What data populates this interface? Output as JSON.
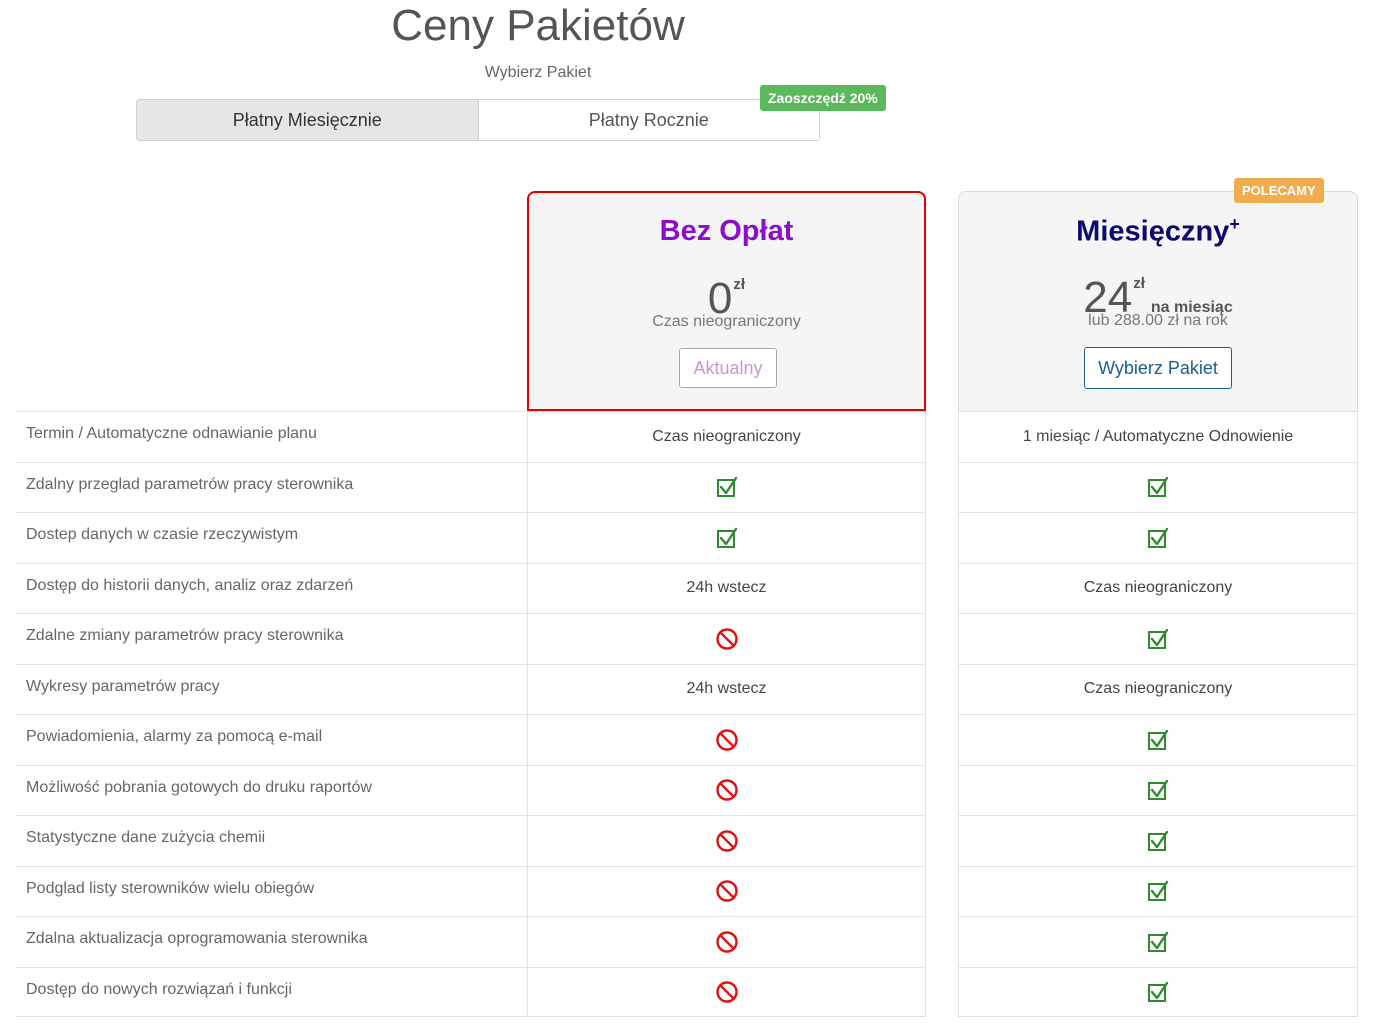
{
  "header": {
    "title": "Ceny Pakietów",
    "subtitle": "Wybierz Pakiet"
  },
  "billing": {
    "monthly_label": "Płatny Miesięcznie",
    "yearly_label": "Płatny Rocznie",
    "save_badge": "Zaoszczędź 20%",
    "active": "monthly"
  },
  "plans": [
    {
      "name": "Bez Opłat",
      "price": "0",
      "currency": "zł",
      "note": "Czas nieograniczony",
      "button_label": "Aktualny"
    },
    {
      "name": "Miesięczny",
      "name_suffix": "+",
      "price": "24",
      "currency": "zł",
      "period": "na miesiąc",
      "note": "lub 288.00 zł na rok",
      "button_label": "Wybierz Pakiet",
      "badge": "POLECAMY"
    }
  ],
  "features": [
    {
      "label": "Termin / Automatyczne odnawianie planu",
      "free": "Czas nieograniczony",
      "monthly": "1 miesiąc / Automatyczne Odnowienie"
    },
    {
      "label": "Zdalny przeglad parametrów pracy sterownika",
      "free": "check",
      "monthly": "check"
    },
    {
      "label": "Dostep danych w czasie rzeczywistym",
      "free": "check",
      "monthly": "check"
    },
    {
      "label": "Dostęp do historii danych, analiz oraz zdarzeń",
      "free": "24h wstecz",
      "monthly": "Czas nieograniczony"
    },
    {
      "label": "Zdalne zmiany parametrów pracy sterownika",
      "free": "no",
      "monthly": "check"
    },
    {
      "label": "Wykresy parametrów pracy",
      "free": "24h wstecz",
      "monthly": "Czas nieograniczony"
    },
    {
      "label": "Powiadomienia, alarmy za pomocą e-mail",
      "free": "no",
      "monthly": "check"
    },
    {
      "label": "Możliwość pobrania gotowych do druku raportów",
      "free": "no",
      "monthly": "check"
    },
    {
      "label": "Statystyczne dane zużycia chemii",
      "free": "no",
      "monthly": "check"
    },
    {
      "label": "Podglad listy sterowników wielu obiegów",
      "free": "no",
      "monthly": "check"
    },
    {
      "label": "Zdalna aktualizacja oprogramowania sterownika",
      "free": "no",
      "monthly": "check"
    },
    {
      "label": "Dostęp do nowych rozwiązań i funkcji",
      "free": "no",
      "monthly": "check"
    }
  ],
  "icons": {
    "check": "check-square-icon",
    "no": "forbidden-icon"
  },
  "colors": {
    "free_border": "#e00000",
    "free_name": "#8b0fc9",
    "monthly_name": "#0b0b6e",
    "check": "#2e8b2e",
    "forbidden": "#e01010",
    "save_badge": "#5cb85c",
    "rec_badge": "#f0ad4e"
  }
}
